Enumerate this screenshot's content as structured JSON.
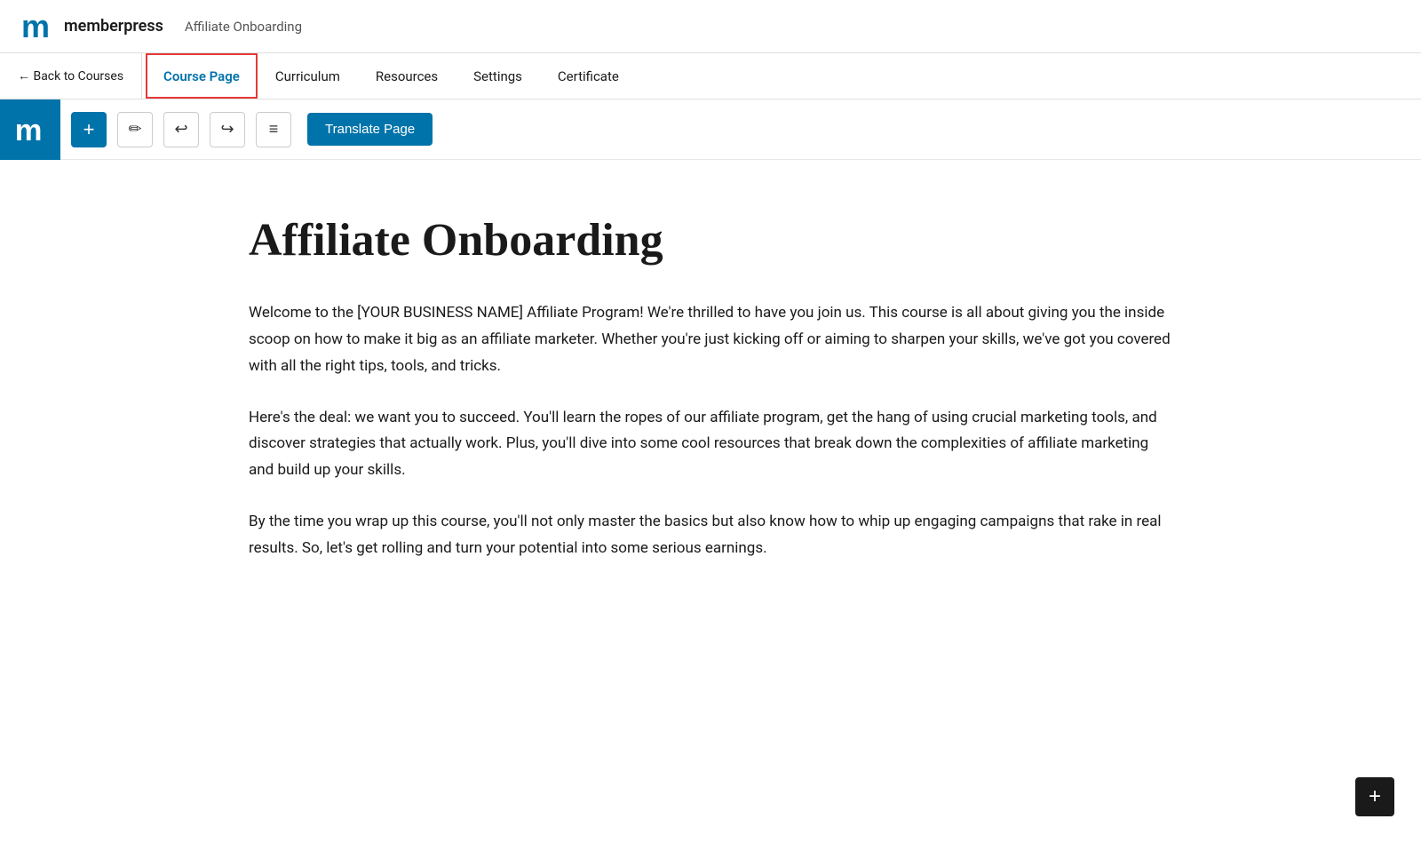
{
  "brand": {
    "logo_alt": "memberpress logo",
    "name": "memberpress"
  },
  "top_nav": {
    "course_title": "Affiliate Onboarding"
  },
  "tab_nav": {
    "back_label": "← Back to Courses",
    "tabs": [
      {
        "id": "course-page",
        "label": "Course Page",
        "active": true
      },
      {
        "id": "curriculum",
        "label": "Curriculum",
        "active": false
      },
      {
        "id": "resources",
        "label": "Resources",
        "active": false
      },
      {
        "id": "settings",
        "label": "Settings",
        "active": false
      },
      {
        "id": "certificate",
        "label": "Certificate",
        "active": false
      }
    ]
  },
  "toolbar": {
    "add_label": "+",
    "translate_label": "Translate Page"
  },
  "content": {
    "heading": "Affiliate Onboarding",
    "paragraphs": [
      "Welcome to the [YOUR BUSINESS NAME] Affiliate Program! We're thrilled to have you join us. This course is all about giving you the inside scoop on how to make it big as an affiliate marketer. Whether you're just kicking off or aiming to sharpen your skills, we've got you covered with all the right tips, tools, and tricks.",
      "Here's the deal: we want you to succeed. You'll learn the ropes of our affiliate program, get the hang of using crucial marketing tools, and discover strategies that actually work. Plus, you'll dive into some cool resources that break down the complexities of affiliate marketing and build up your skills.",
      "By the time you wrap up this course, you'll not only master the basics but also know how to whip up engaging campaigns that rake in real results. So, let's get rolling and turn your potential into some serious earnings."
    ]
  },
  "bottom_add": {
    "label": "+"
  }
}
